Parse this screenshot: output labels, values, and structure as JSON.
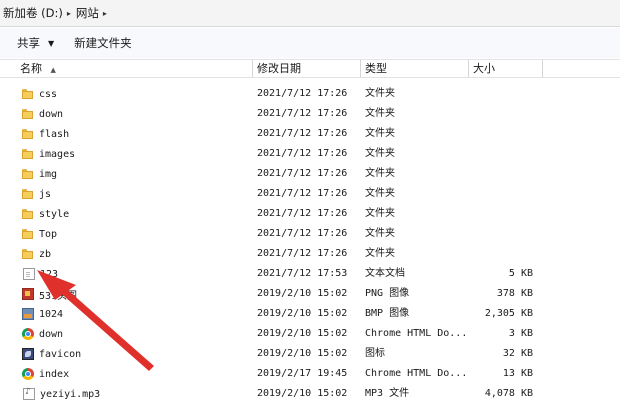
{
  "breadcrumb": {
    "items": [
      {
        "label": "新加卷 (D:)",
        "sep": "▸"
      },
      {
        "label": "网站",
        "sep": "▸"
      }
    ]
  },
  "toolbar": {
    "share_label": "共享",
    "share_dropdown": "▼",
    "new_folder_label": "新建文件夹"
  },
  "columns": {
    "name": "名称",
    "sort_indicator": "▲",
    "date": "修改日期",
    "type": "类型",
    "size": "大小"
  },
  "files": [
    {
      "icon": "folder-icon",
      "name": "css",
      "date": "2021/7/12 17:26",
      "type": "文件夹",
      "size": ""
    },
    {
      "icon": "folder-icon",
      "name": "down",
      "date": "2021/7/12 17:26",
      "type": "文件夹",
      "size": ""
    },
    {
      "icon": "folder-icon",
      "name": "flash",
      "date": "2021/7/12 17:26",
      "type": "文件夹",
      "size": ""
    },
    {
      "icon": "folder-icon",
      "name": "images",
      "date": "2021/7/12 17:26",
      "type": "文件夹",
      "size": ""
    },
    {
      "icon": "folder-icon",
      "name": "img",
      "date": "2021/7/12 17:26",
      "type": "文件夹",
      "size": ""
    },
    {
      "icon": "folder-icon",
      "name": "js",
      "date": "2021/7/12 17:26",
      "type": "文件夹",
      "size": ""
    },
    {
      "icon": "folder-icon",
      "name": "style",
      "date": "2021/7/12 17:26",
      "type": "文件夹",
      "size": ""
    },
    {
      "icon": "folder-icon",
      "name": "Top",
      "date": "2021/7/12 17:26",
      "type": "文件夹",
      "size": ""
    },
    {
      "icon": "folder-icon",
      "name": "zb",
      "date": "2021/7/12 17:26",
      "type": "文件夹",
      "size": ""
    },
    {
      "icon": "text-file-icon",
      "name": "123",
      "date": "2021/7/12 17:53",
      "type": "文本文档",
      "size": "5 KB"
    },
    {
      "icon": "png-image-icon",
      "name": "531头图",
      "date": "2019/2/10 15:02",
      "type": "PNG 图像",
      "size": "378 KB"
    },
    {
      "icon": "bmp-image-icon",
      "name": "1024",
      "date": "2019/2/10 15:02",
      "type": "BMP 图像",
      "size": "2,305 KB"
    },
    {
      "icon": "chrome-html-icon",
      "name": "down",
      "date": "2019/2/10 15:02",
      "type": "Chrome HTML Do...",
      "size": "3 KB"
    },
    {
      "icon": "favicon-icon",
      "name": "favicon",
      "date": "2019/2/10 15:02",
      "type": "图标",
      "size": "32 KB"
    },
    {
      "icon": "chrome-html-icon",
      "name": "index",
      "date": "2019/2/17 19:45",
      "type": "Chrome HTML Do...",
      "size": "13 KB"
    },
    {
      "icon": "mp3-file-icon",
      "name": "yeziyi.mp3",
      "date": "2019/2/10 15:02",
      "type": "MP3 文件",
      "size": "4,078 KB"
    }
  ],
  "colors": {
    "folder": "#f5cd5b",
    "annotation_arrow": "#e0302c"
  }
}
